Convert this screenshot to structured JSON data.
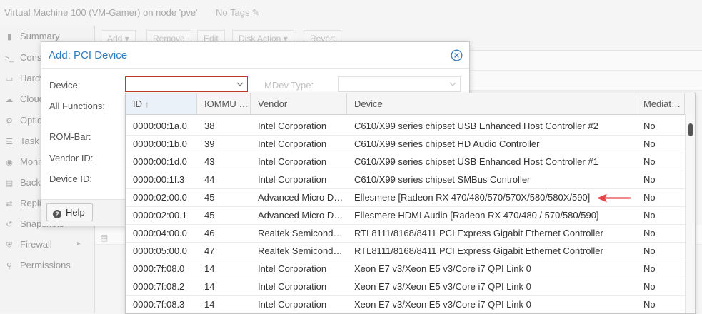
{
  "window": {
    "title": "Virtual Machine 100 (VM-Gamer) on node 'pve'",
    "tags": "No Tags"
  },
  "sidebar": {
    "items": [
      {
        "label": "Summary",
        "icon": "book-icon"
      },
      {
        "label": "Console",
        "icon": "terminal-icon"
      },
      {
        "label": "Hardware",
        "icon": "monitor-icon"
      },
      {
        "label": "Cloud-Init",
        "icon": "cloud-icon"
      },
      {
        "label": "Options",
        "icon": "gear-icon"
      },
      {
        "label": "Task History",
        "icon": "list-icon"
      },
      {
        "label": "Monitor",
        "icon": "eye-icon"
      },
      {
        "label": "Backup",
        "icon": "floppy-icon"
      },
      {
        "label": "Replication",
        "icon": "retweet-icon"
      },
      {
        "label": "Snapshots",
        "icon": "history-icon"
      },
      {
        "label": "Firewall",
        "icon": "shield-icon"
      },
      {
        "label": "Permissions",
        "icon": "unlock-icon"
      }
    ]
  },
  "toolbar": {
    "add": "Add",
    "remove": "Remove",
    "edit": "Edit",
    "disk_action": "Disk Action",
    "revert": "Revert"
  },
  "dialog": {
    "title": "Add: PCI Device",
    "device_label": "Device:",
    "device_value": "",
    "mdev_label": "MDev Type:",
    "all_functions_label": "All Functions:",
    "rombar_label": "ROM-Bar:",
    "vendor_id_label": "Vendor ID:",
    "device_id_label": "Device ID:",
    "help": "Help"
  },
  "grid": {
    "columns": [
      "ID",
      "IOMMU Group",
      "Vendor",
      "Device",
      "Mediated Devices"
    ],
    "rows": [
      [
        "0000:00:1a.0",
        "38",
        "Intel Corporation",
        "C610/X99 series chipset USB Enhanced Host Controller #2",
        "No"
      ],
      [
        "0000:00:1b.0",
        "39",
        "Intel Corporation",
        "C610/X99 series chipset HD Audio Controller",
        "No"
      ],
      [
        "0000:00:1d.0",
        "43",
        "Intel Corporation",
        "C610/X99 series chipset USB Enhanced Host Controller #1",
        "No"
      ],
      [
        "0000:00:1f.3",
        "44",
        "Intel Corporation",
        "C610/X99 series chipset SMBus Controller",
        "No"
      ],
      [
        "0000:02:00.0",
        "45",
        "Advanced Micro Devices, Inc. [AMD/ATI]",
        "Ellesmere [Radeon RX 470/480/570/570X/580/580X/590]",
        "No"
      ],
      [
        "0000:02:00.1",
        "45",
        "Advanced Micro Devices, Inc. [AMD/ATI]",
        "Ellesmere HDMI Audio [Radeon RX 470/480 / 570/580/590]",
        "No"
      ],
      [
        "0000:04:00.0",
        "46",
        "Realtek Semiconductor Co., Ltd.",
        "RTL8111/8168/8411 PCI Express Gigabit Ethernet Controller",
        "No"
      ],
      [
        "0000:05:00.0",
        "47",
        "Realtek Semiconductor Co., Ltd.",
        "RTL8111/8168/8411 PCI Express Gigabit Ethernet Controller",
        "No"
      ],
      [
        "0000:7f:08.0",
        "14",
        "Intel Corporation",
        "Xeon E7 v3/Xeon E5 v3/Core i7 QPI Link 0",
        "No"
      ],
      [
        "0000:7f:08.2",
        "14",
        "Intel Corporation",
        "Xeon E7 v3/Xeon E5 v3/Core i7 QPI Link 0",
        "No"
      ],
      [
        "0000:7f:08.3",
        "14",
        "Intel Corporation",
        "Xeon E7 v3/Xeon E5 v3/Core i7 QPI Link 0",
        "No"
      ]
    ]
  },
  "colors": {
    "accent": "#2f7bbd",
    "error_border": "#c0392b",
    "annotation_arrow": "#e8454a"
  }
}
